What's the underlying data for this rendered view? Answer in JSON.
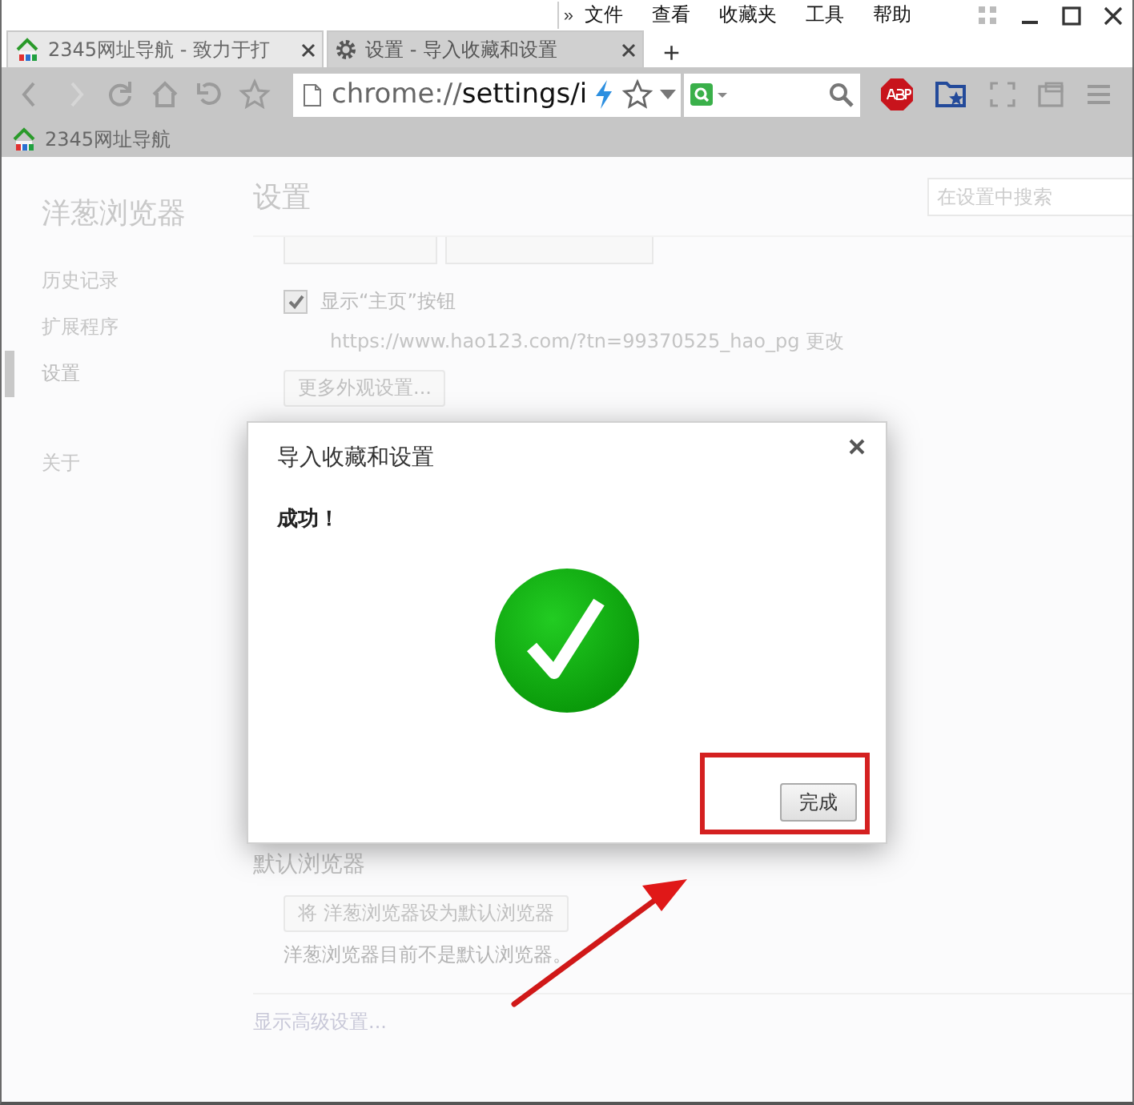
{
  "menu_overflow": "»",
  "menu": [
    "文件",
    "查看",
    "收藏夹",
    "工具",
    "帮助"
  ],
  "tabs": [
    {
      "kind": "site",
      "title": "2345网址导航 - 致力于打",
      "selected": false
    },
    {
      "kind": "settings",
      "title": "设置 - 导入收藏和设置",
      "selected": true
    }
  ],
  "new_tab": "+",
  "nav_buttons": [
    {
      "kind": "back",
      "disabled": false
    },
    {
      "kind": "forward",
      "disabled": true
    },
    {
      "kind": "reload",
      "disabled": false
    },
    {
      "kind": "home",
      "disabled": false
    },
    {
      "kind": "undo",
      "disabled": false
    },
    {
      "kind": "star",
      "disabled": false
    }
  ],
  "address_bar": {
    "url": "chrome://settings/i"
  },
  "bookmarks": [
    {
      "title": "2345网址导航"
    }
  ],
  "sidebar": {
    "title": "洋葱浏览器",
    "groups": [
      [
        {
          "label": "历史记录",
          "selected": false
        },
        {
          "label": "扩展程序",
          "selected": false
        },
        {
          "label": "设置",
          "selected": true
        }
      ],
      [
        {
          "label": "关于",
          "selected": false
        }
      ]
    ]
  },
  "page": {
    "title": "设置",
    "search_placeholder": "在设置中搜索",
    "home_button": {
      "label": "显示“主页”按钮",
      "checked": true,
      "url": "https://www.hao123.com/?tn=99370525_hao_pg",
      "change_link": "更改"
    },
    "more_appearance_button": "更多外观设置...",
    "default_browser": {
      "heading": "默认浏览器",
      "button": "将 洋葱浏览器设为默认浏览器",
      "note": "洋葱浏览器目前不是默认浏览器。"
    },
    "advanced_link": "显示高级设置..."
  },
  "dialog": {
    "title": "导入收藏和设置",
    "message": "成功！",
    "button": "完成"
  }
}
